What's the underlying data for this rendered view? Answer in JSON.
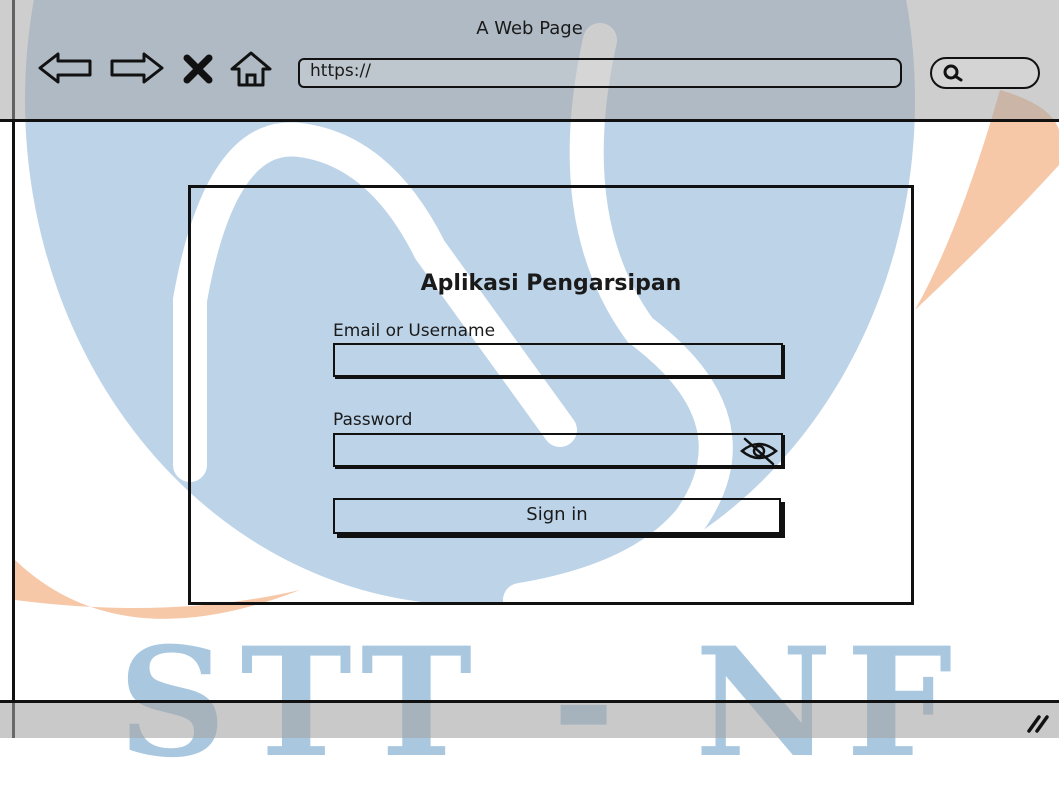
{
  "browser": {
    "title": "A Web Page",
    "url": "https://",
    "search_value": ""
  },
  "login": {
    "title": "Aplikasi Pengarsipan",
    "email_label": "Email or Username",
    "email_value": "",
    "password_label": "Password",
    "password_value": "",
    "signin_label": "Sign in"
  },
  "watermark": {
    "text": "STT - NF",
    "colors": {
      "blue": "#bcd3e8",
      "orange": "#f6c8a8"
    }
  },
  "icons": [
    "back-arrow-icon",
    "forward-arrow-icon",
    "stop-icon",
    "home-icon",
    "search-icon",
    "eye-slash-icon",
    "resize-grip-icon"
  ]
}
